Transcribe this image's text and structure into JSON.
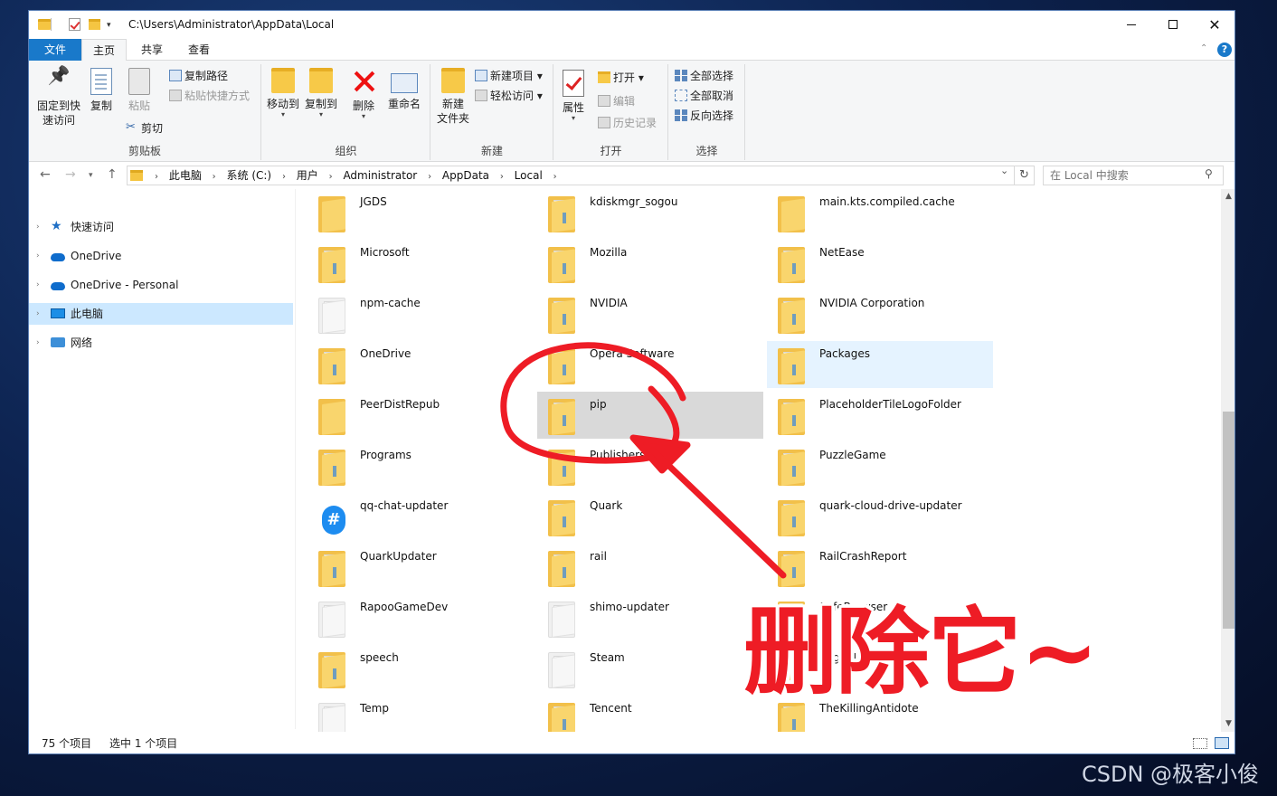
{
  "window": {
    "title_path": "C:\\Users\\Administrator\\AppData\\Local",
    "controls": {
      "minimize": "—",
      "maximize": "☐",
      "close": "✕"
    }
  },
  "menu_tabs": {
    "file": "文件",
    "home": "主页",
    "share": "共享",
    "view": "查看"
  },
  "ribbon": {
    "clipboard": {
      "label": "剪贴板",
      "pin": "固定到快\n速访问",
      "pin_line1": "固定到快",
      "pin_line2": "速访问",
      "copy": "复制",
      "paste": "粘贴",
      "copy_path": "复制路径",
      "paste_shortcut": "粘贴快捷方式",
      "cut": "剪切"
    },
    "organize": {
      "label": "组织",
      "move_to": "移动到",
      "copy_to": "复制到",
      "delete": "删除",
      "rename": "重命名"
    },
    "new": {
      "label": "新建",
      "new_folder_line1": "新建",
      "new_folder_line2": "文件夹",
      "new_item": "新建项目",
      "easy_access": "轻松访问"
    },
    "open": {
      "label": "打开",
      "properties": "属性",
      "open": "打开",
      "edit": "编辑",
      "history": "历史记录"
    },
    "select": {
      "label": "选择",
      "select_all": "全部选择",
      "select_none": "全部取消",
      "invert": "反向选择"
    }
  },
  "address": {
    "crumbs": [
      "此电脑",
      "系统 (C:)",
      "用户",
      "Administrator",
      "AppData",
      "Local"
    ],
    "search_placeholder": "在 Local 中搜索"
  },
  "nav_pane": {
    "items": [
      {
        "label": "快速访问",
        "icon": "star-icon"
      },
      {
        "label": "OneDrive",
        "icon": "cloud-icon"
      },
      {
        "label": "OneDrive - Personal",
        "icon": "cloud-icon"
      },
      {
        "label": "此电脑",
        "icon": "computer-icon",
        "selected": true
      },
      {
        "label": "网络",
        "icon": "network-icon"
      }
    ]
  },
  "files": [
    [
      "JGDS",
      "kdiskmgr_sogou",
      "main.kts.compiled.cache"
    ],
    [
      "Microsoft",
      "Mozilla",
      "NetEase"
    ],
    [
      "npm-cache",
      "NVIDIA",
      "NVIDIA Corporation"
    ],
    [
      "OneDrive",
      "Opera Software",
      "Packages"
    ],
    [
      "PeerDistRepub",
      "pip",
      "PlaceholderTileLogoFolder"
    ],
    [
      "Programs",
      "Publishers",
      "PuzzleGame"
    ],
    [
      "qq-chat-updater",
      "Quark",
      "quark-cloud-drive-updater"
    ],
    [
      "QuarkUpdater",
      "rail",
      "RailCrashReport"
    ],
    [
      "RapooGameDev",
      "shimo-updater",
      "SafeBrowser"
    ],
    [
      "speech",
      "Steam",
      "SogouInput"
    ],
    [
      "Temp",
      "Tencent",
      "TheKillingAntidote"
    ]
  ],
  "status": {
    "count": "75 个项目",
    "selected": "选中 1 个项目"
  },
  "annotation": {
    "text": "删除它~",
    "color": "#ee1c25"
  },
  "watermark": "CSDN @极客小俊"
}
